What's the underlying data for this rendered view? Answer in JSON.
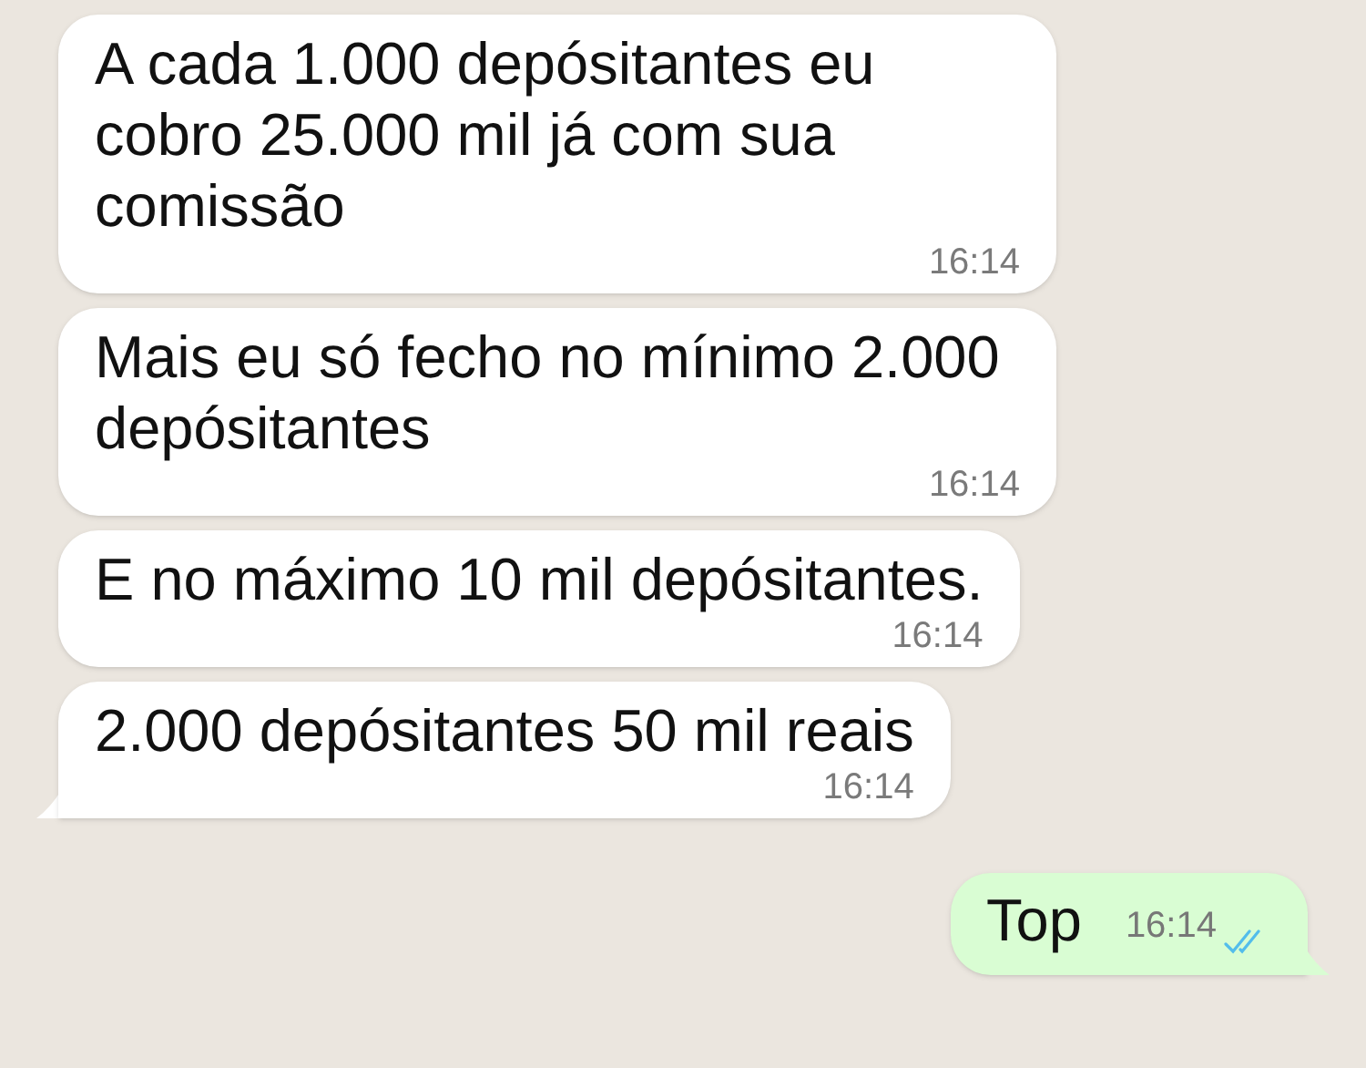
{
  "messages": [
    {
      "kind": "incoming",
      "text": "A cada 1.000 depósitantes eu cobro 25.000 mil já com sua comissão",
      "time": "16:14",
      "tail": false
    },
    {
      "kind": "incoming",
      "text": "Mais eu só fecho no mínimo 2.000 depósitantes",
      "time": "16:14",
      "tail": false
    },
    {
      "kind": "incoming",
      "text": "E no máximo 10 mil depósitantes.",
      "time": "16:14",
      "tail": false
    },
    {
      "kind": "incoming",
      "text": "2.000 depósitantes 50 mil reais",
      "time": "16:14",
      "tail": true
    },
    {
      "kind": "outgoing",
      "text": "Top",
      "time": "16:14",
      "tail": true,
      "read": true
    }
  ]
}
